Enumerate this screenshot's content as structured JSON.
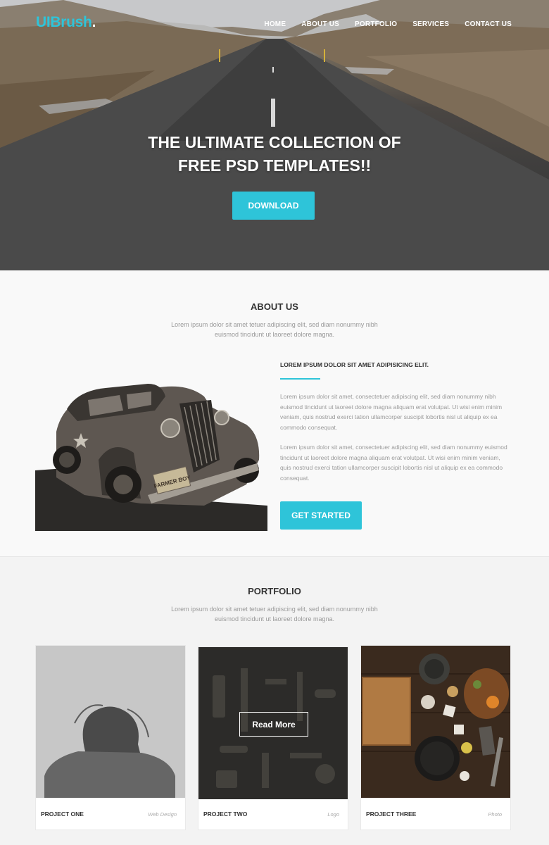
{
  "header": {
    "logo": "UIBrush",
    "logo_dot": ".",
    "nav": [
      "HOME",
      "ABOUT US",
      "PORTFOLIO",
      "SERVICES",
      "CONTACT US"
    ]
  },
  "hero": {
    "title_line1": "THE ULTIMATE COLLECTION OF",
    "title_line2": "FREE PSD TEMPLATES!!",
    "button": "DOWNLOAD"
  },
  "about": {
    "title": "ABOUT US",
    "subtitle_line1": "Lorem ipsum dolor sit amet tetuer adipiscing elit, sed diam nonummy nibh",
    "subtitle_line2": "euismod tincidunt ut laoreet dolore magna.",
    "heading": "LOREM IPSUM DOLOR SIT AMET ADIPISICING ELIT.",
    "para1": "Lorem ipsum dolor sit amet, consectetuer adipiscing elit, sed diam nonummy nibh euismod tincidunt ut laoreet dolore magna aliquam erat volutpat. Ut wisi enim minim veniam, quis nostrud exerci tation ullamcorper suscipit lobortis nisl ut aliquip ex ea commodo consequat.",
    "para2": "Lorem ipsum dolor sit amet, consectetuer adipiscing elit, sed diam nonummy euismod tincidunt ut laoreet dolore magna aliquam erat volutpat. Ut wisi enim minim veniam, quis nostrud exerci tation ullamcorper suscipit lobortis nisl ut aliquip ex ea commodo consequat.",
    "button": "GET STARTED",
    "plate_text": "FARMER BOY"
  },
  "portfolio": {
    "title": "PORTFOLIO",
    "subtitle_line1": "Lorem ipsum dolor sit amet tetuer adipiscing elit, sed diam nonummy nibh",
    "subtitle_line2": "euismod tincidunt ut laoreet dolore magna.",
    "read_more": "Read More",
    "projects": [
      {
        "name": "PROJECT ONE",
        "category": "Web Design"
      },
      {
        "name": "PROJECT TWO",
        "category": "Logo"
      },
      {
        "name": "PROJECT THREE",
        "category": "Photo"
      }
    ]
  },
  "colors": {
    "accent": "#2ec4d9",
    "text_dark": "#333333",
    "text_muted": "#9a9a9a"
  }
}
